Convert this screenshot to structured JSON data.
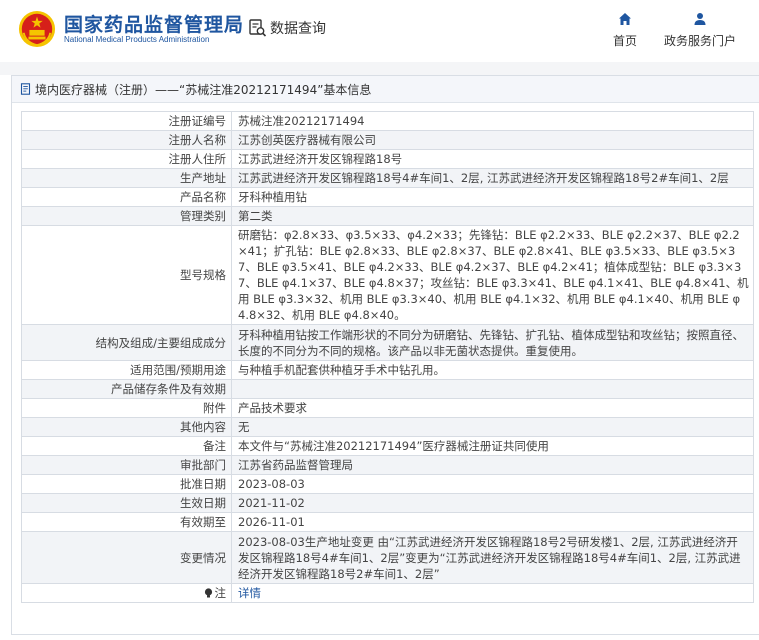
{
  "header": {
    "logo_cn": "国家药品监督管理局",
    "logo_en": "National Medical Products Administration",
    "data_query": "数据查询",
    "nav": [
      {
        "label": "首页",
        "icon": "home-icon"
      },
      {
        "label": "政务服务门户",
        "icon": "user-icon"
      }
    ]
  },
  "colors": {
    "brand": "#1f56a0",
    "emblem_red": "#d6201a",
    "emblem_gold": "#f5c400"
  },
  "breadcrumb": "境内医疗器械（注册）——“苏械注准20212171494”基本信息",
  "rows": [
    {
      "label": "注册证编号",
      "value": "苏械注准20212171494"
    },
    {
      "label": "注册人名称",
      "value": "江苏创英医疗器械有限公司"
    },
    {
      "label": "注册人住所",
      "value": "江苏武进经济开发区锦程路18号"
    },
    {
      "label": "生产地址",
      "value": "江苏武进经济开发区锦程路18号4#车间1、2层, 江苏武进经济开发区锦程路18号2#车间1、2层"
    },
    {
      "label": "产品名称",
      "value": "牙科种植用钻"
    },
    {
      "label": "管理类别",
      "value": "第二类"
    },
    {
      "label": "型号规格",
      "value": "研磨钻：φ2.8×33、φ3.5×33、φ4.2×33；先锋钻：BLE φ2.2×33、BLE φ2.2×37、BLE φ2.2×41；扩孔钻：BLE φ2.8×33、BLE φ2.8×37、BLE φ2.8×41、BLE φ3.5×33、BLE φ3.5×37、BLE φ3.5×41、BLE φ4.2×33、BLE φ4.2×37、BLE φ4.2×41；植体成型钻：BLE φ3.3×37、BLE φ4.1×37、BLE φ4.8×37；攻丝钻：BLE φ3.3×41、BLE φ4.1×41、BLE φ4.8×41、机用 BLE φ3.3×32、机用 BLE φ3.3×40、机用 BLE φ4.1×32、机用 BLE φ4.1×40、机用 BLE φ4.8×32、机用 BLE φ4.8×40。"
    },
    {
      "label": "结构及组成/主要组成成分",
      "value": "牙科种植用钻按工作端形状的不同分为研磨钻、先锋钻、扩孔钻、植体成型钻和攻丝钻；按照直径、长度的不同分为不同的规格。该产品以非无菌状态提供。重复使用。"
    },
    {
      "label": "适用范围/预期用途",
      "value": "与种植手机配套供种植牙手术中钻孔用。"
    },
    {
      "label": "产品储存条件及有效期",
      "value": ""
    },
    {
      "label": "附件",
      "value": "产品技术要求"
    },
    {
      "label": "其他内容",
      "value": "无"
    },
    {
      "label": "备注",
      "value": "本文件与“苏械注准20212171494”医疗器械注册证共同使用"
    },
    {
      "label": "审批部门",
      "value": "江苏省药品监督管理局"
    },
    {
      "label": "批准日期",
      "value": "2023-08-03"
    },
    {
      "label": "生效日期",
      "value": "2021-11-02"
    },
    {
      "label": "有效期至",
      "value": "2026-11-01"
    },
    {
      "label": "变更情况",
      "value": "2023-08-03生产地址变更 由“江苏武进经济开发区锦程路18号2号研发楼1、2层, 江苏武进经济开发区锦程路18号4#车间1、2层”变更为“江苏武进经济开发区锦程路18号4#车间1、2层, 江苏武进经济开发区锦程路18号2#车间1、2层”"
    }
  ],
  "note_row": {
    "label": "注",
    "value": "详情",
    "icon": "lightbulb-icon"
  }
}
